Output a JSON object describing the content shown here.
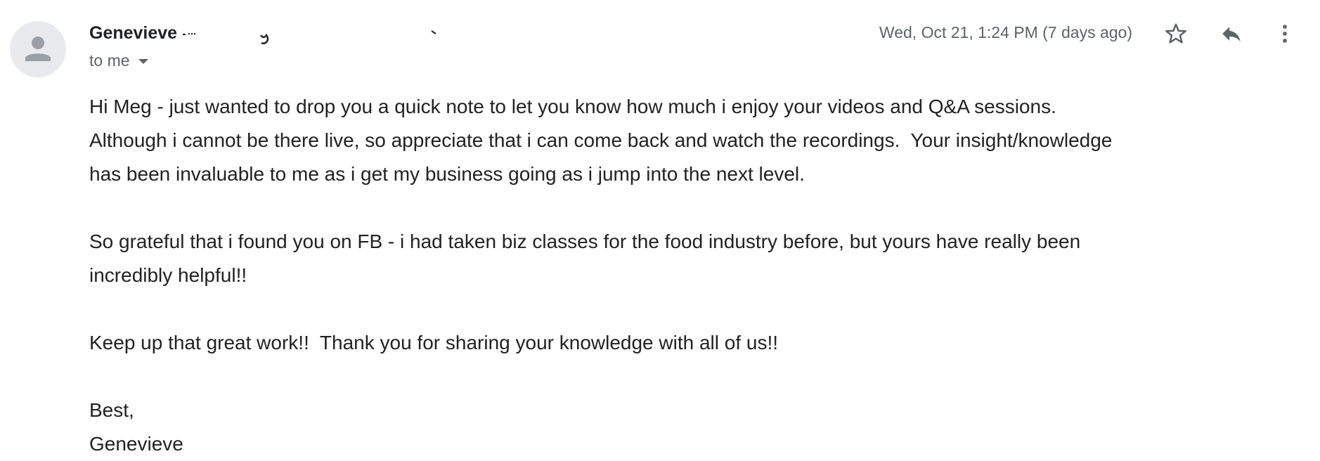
{
  "email": {
    "sender_name": "Genevieve",
    "recipient_label": "to me",
    "timestamp": "Wed, Oct 21, 1:24 PM (7 days ago)",
    "icons": {
      "avatar": "person-icon",
      "star": "star-outline-icon",
      "reply": "reply-icon",
      "more": "more-vertical-icon",
      "recipient_toggle": "caret-down-icon"
    },
    "body": {
      "paragraph1_line1": "Hi Meg - just wanted to drop you a quick note to let you know how much i enjoy your videos and Q&A sessions.",
      "paragraph1_line2": "Although i cannot be there live, so appreciate that i can come back and watch the recordings.  Your insight/knowledge",
      "paragraph1_line3": "has been invaluable to me as i get my business going as i jump into the next level.",
      "paragraph2_line1": "So grateful that i found you on FB - i had taken biz classes for the food industry before, but yours have really been",
      "paragraph2_line2": "incredibly helpful!!",
      "paragraph3_line1": "Keep up that great work!!  Thank you for sharing your knowledge with all of us!!",
      "signoff": "Best,",
      "signature": "Genevieve"
    }
  }
}
